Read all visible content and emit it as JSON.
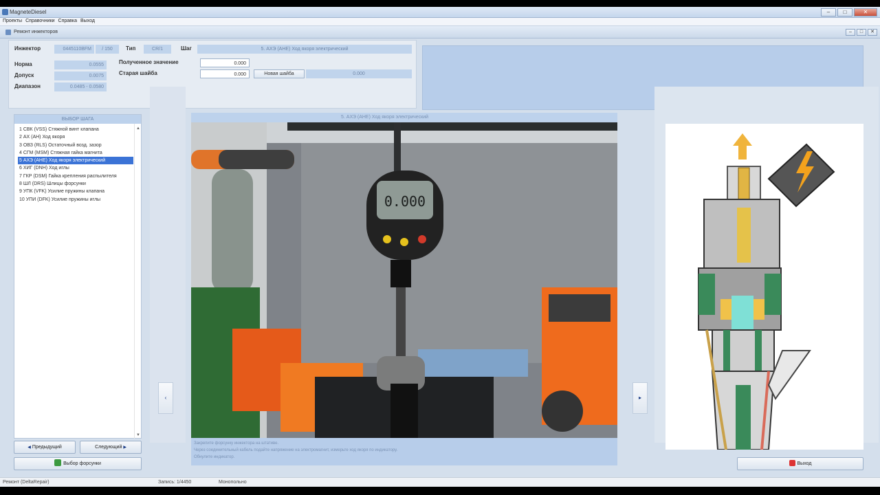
{
  "window": {
    "title": "MagneteDiesel"
  },
  "menu": [
    "Проекты",
    "Справочники",
    "Справка",
    "Выход"
  ],
  "form": {
    "title": "Ремонт инжекторов"
  },
  "injector": {
    "injector_label": "Инжектор",
    "injector_value": "0445110BFM",
    "injector_extra": "/ 150",
    "type_label": "Тип",
    "type_value": "CR/1",
    "step_label": "Шаг",
    "step_value": "5. АХЭ (AHE)   Ход якоря электрический",
    "norm_label": "Норма",
    "norm_value": "0.0555",
    "tol_label": "Допуск",
    "tol_value": "0.0075",
    "range_label": "Диапазон",
    "range_min": "0.0485",
    "range_max": "0.0580",
    "received_label": "Полученное значение",
    "received_value": "0.000",
    "old_shim_label": "Старая шайба",
    "old_shim_value": "0.000",
    "new_shim_button": "Новая шайба",
    "new_shim_value": "0.000"
  },
  "steps": {
    "header": "ВЫБОР ШАГА",
    "items": [
      "1  СВК (VSS)   Стяжной винт клапана",
      "2  АХ (AH)   Ход якоря",
      "3  ОВЗ (RLS)   Остаточный возд. зазор",
      "4  СГМ (MSM)   Стяжная гайка магнита",
      "5  АХЭ (AHE)   Ход якоря электрический",
      "6  ХИГ (DNH)   Ход иглы",
      "7  ГКР (DSM)   Гайка крепления распылителя",
      "8  ШЛ (DRS)   Шлицы форсунки",
      "9  УПК (VFK)   Усилие пружины клапана",
      "10  УПИ (DFK)   Усилие пружины иглы"
    ],
    "selected_index": 4
  },
  "buttons": {
    "prev": "Предыдущий",
    "next": "Следующий",
    "select_injector": "Выбор форсунки",
    "exit": "Выход"
  },
  "center": {
    "header": "5. АХЭ (AHE)   Ход якоря электрический",
    "gauge_reading": "0.000",
    "description": [
      "Закрепите форсунку инжектора на штативе.",
      "Через соединительный кабель подайте напряжение на электромагнит, измерьте ход якоря по индикатору.",
      "Обнулите индикатор."
    ]
  },
  "status": {
    "left": "Ремонт (DeltaRepair)",
    "records": "Запись: 1/4450",
    "mode": "Монопольно"
  },
  "colors": {
    "accent": "#3b73d6",
    "panel": "#bdd2ec",
    "background": "#d4dfec"
  }
}
